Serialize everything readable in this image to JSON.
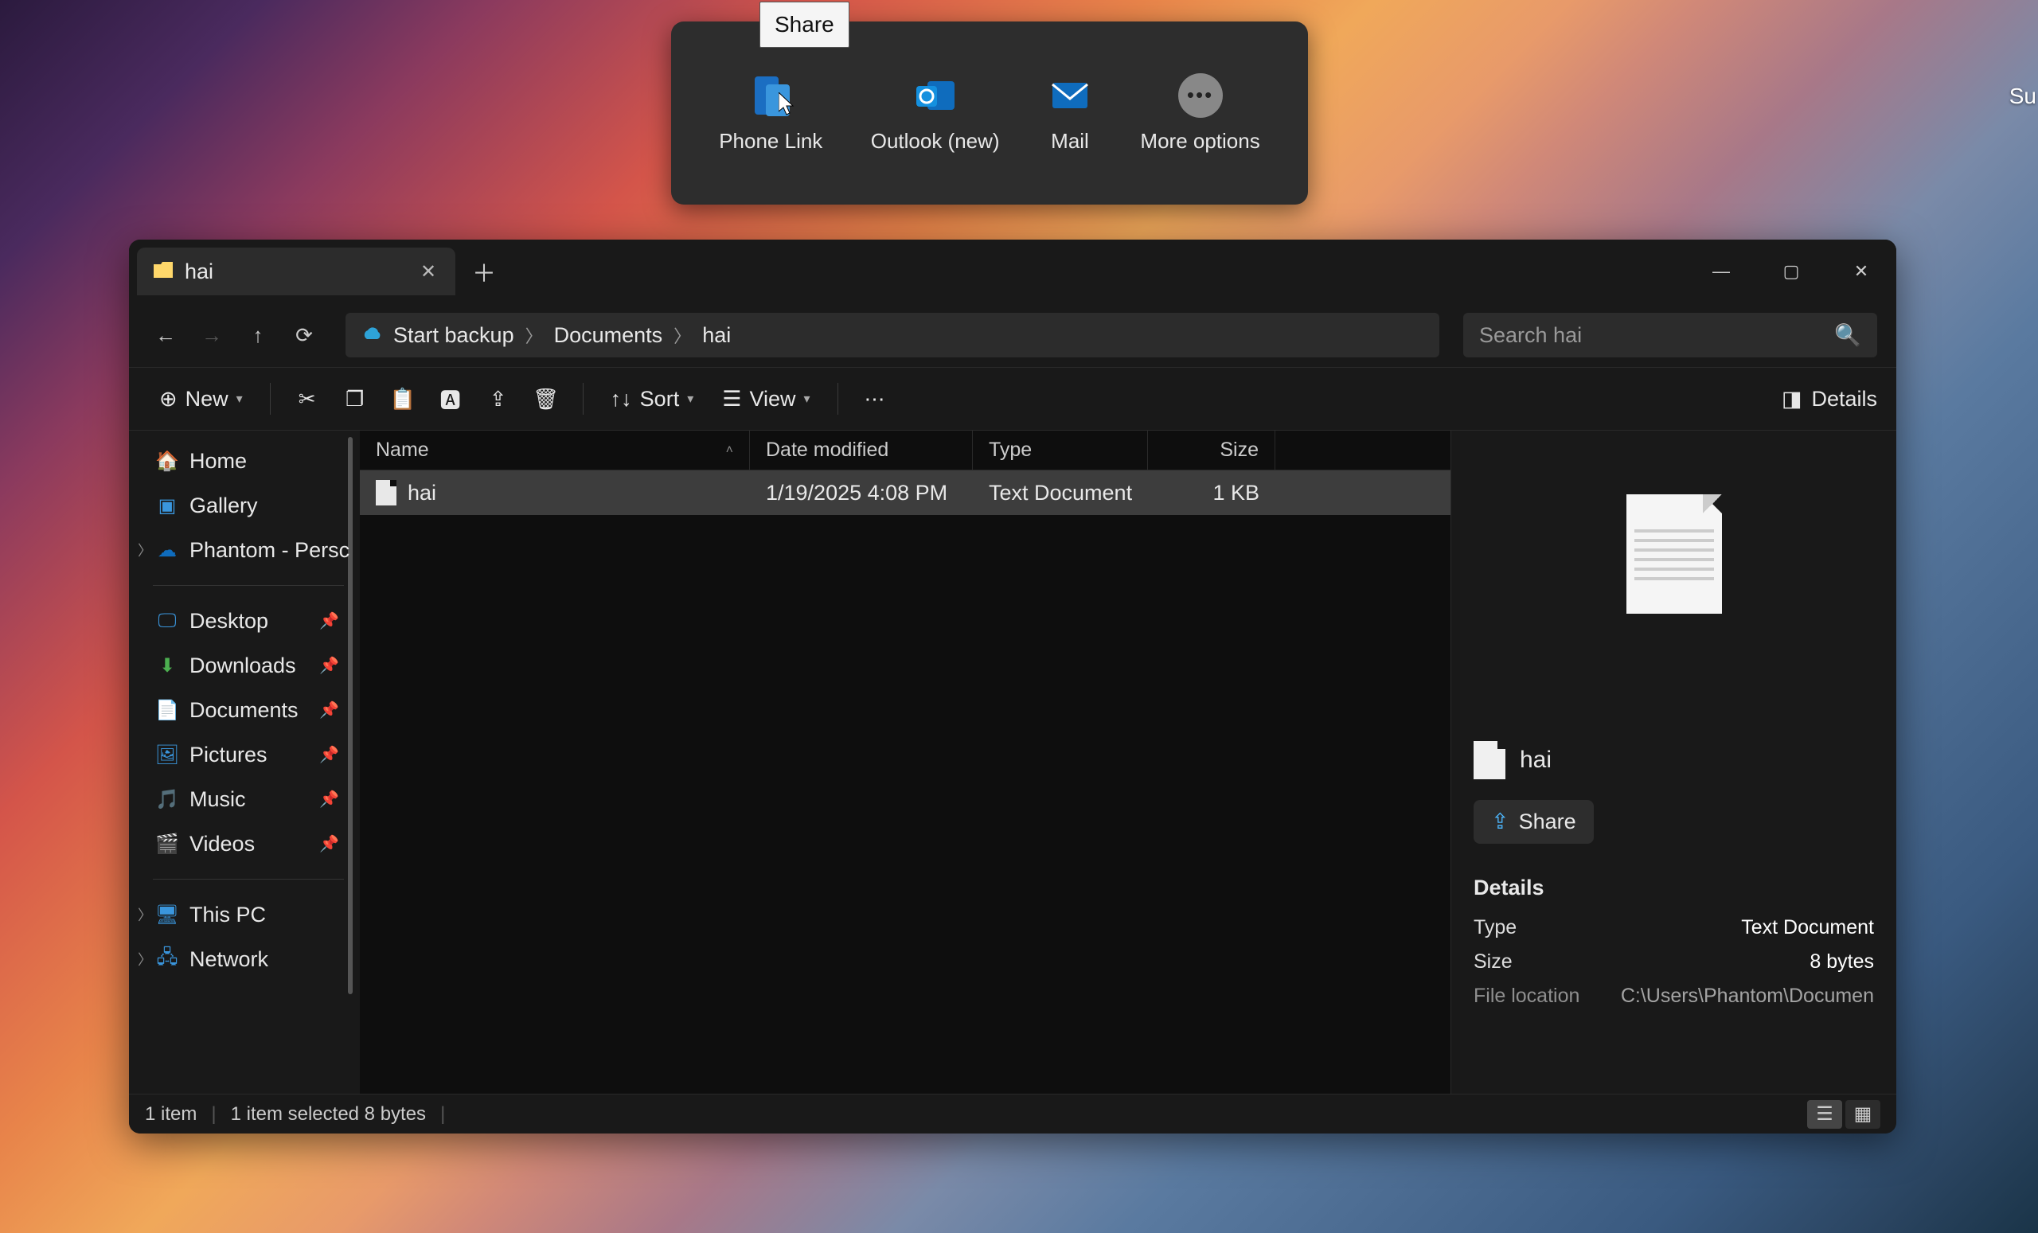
{
  "share": {
    "tooltip": "Share",
    "options": [
      {
        "label": "Phone Link",
        "icon": "phone-link"
      },
      {
        "label": "Outlook (new)",
        "icon": "outlook"
      },
      {
        "label": "Mail",
        "icon": "mail"
      },
      {
        "label": "More options",
        "icon": "more"
      }
    ]
  },
  "window": {
    "tab_title": "hai",
    "controls": {
      "minimize": "—",
      "maximize": "▢",
      "close": "✕"
    }
  },
  "nav": {
    "breadcrumb": [
      {
        "label": "Start backup",
        "icon": "cloud"
      },
      {
        "label": "Documents"
      },
      {
        "label": "hai"
      }
    ],
    "search_placeholder": "Search hai"
  },
  "commands": {
    "new": "New",
    "sort": "Sort",
    "view": "View",
    "details": "Details"
  },
  "sidebar": {
    "top": [
      {
        "label": "Home",
        "icon": "home"
      },
      {
        "label": "Gallery",
        "icon": "gallery"
      },
      {
        "label": "Phantom - Persc",
        "icon": "onedrive",
        "expandable": true
      }
    ],
    "pinned": [
      {
        "label": "Desktop",
        "icon": "desktop"
      },
      {
        "label": "Downloads",
        "icon": "downloads"
      },
      {
        "label": "Documents",
        "icon": "documents"
      },
      {
        "label": "Pictures",
        "icon": "pictures"
      },
      {
        "label": "Music",
        "icon": "music"
      },
      {
        "label": "Videos",
        "icon": "videos"
      }
    ],
    "bottom": [
      {
        "label": "This PC",
        "icon": "thispc",
        "expandable": true
      },
      {
        "label": "Network",
        "icon": "network",
        "expandable": true
      }
    ]
  },
  "columns": {
    "name": "Name",
    "date": "Date modified",
    "type": "Type",
    "size": "Size"
  },
  "files": [
    {
      "name": "hai",
      "date": "1/19/2025 4:08 PM",
      "type": "Text Document",
      "size": "1 KB",
      "selected": true
    }
  ],
  "details_pane": {
    "title": "hai",
    "share": "Share",
    "header": "Details",
    "rows": [
      {
        "key": "Type",
        "val": "Text Document"
      },
      {
        "key": "Size",
        "val": "8 bytes"
      },
      {
        "key": "File location",
        "val": "C:\\Users\\Phantom\\Documen"
      }
    ]
  },
  "status": {
    "count": "1 item",
    "selection": "1 item selected  8 bytes"
  },
  "edge_text": "Su"
}
